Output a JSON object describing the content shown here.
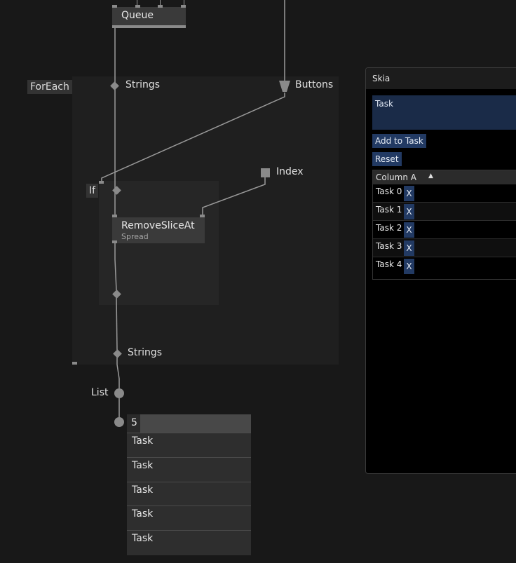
{
  "nodes": {
    "queue": {
      "title": "Queue"
    },
    "remove_slice_at": {
      "title": "RemoveSliceAt",
      "subtitle": "Spread"
    }
  },
  "regions": {
    "foreach": {
      "label": "ForEach"
    },
    "if": {
      "label": "If"
    }
  },
  "pads": {
    "strings_in": "Strings",
    "buttons": "Buttons",
    "index": "Index",
    "strings_out": "Strings",
    "list": "List"
  },
  "spread_viewer": {
    "count": "5",
    "items": [
      "Task",
      "Task",
      "Task",
      "Task",
      "Task"
    ]
  },
  "skia_window": {
    "title": "Skia",
    "task_field": "Task",
    "add_button": "Add to Task",
    "reset_button": "Reset",
    "table": {
      "column_header": "Column A",
      "rows": [
        {
          "value": "Task 0",
          "remove": "X"
        },
        {
          "value": "Task 1",
          "remove": "X"
        },
        {
          "value": "Task 2",
          "remove": "X"
        },
        {
          "value": "Task 3",
          "remove": "X"
        },
        {
          "value": "Task 4",
          "remove": "X"
        }
      ]
    }
  },
  "colors": {
    "background": "#181818",
    "link": "#9a9a9a",
    "accent_blue": "#223a63"
  }
}
